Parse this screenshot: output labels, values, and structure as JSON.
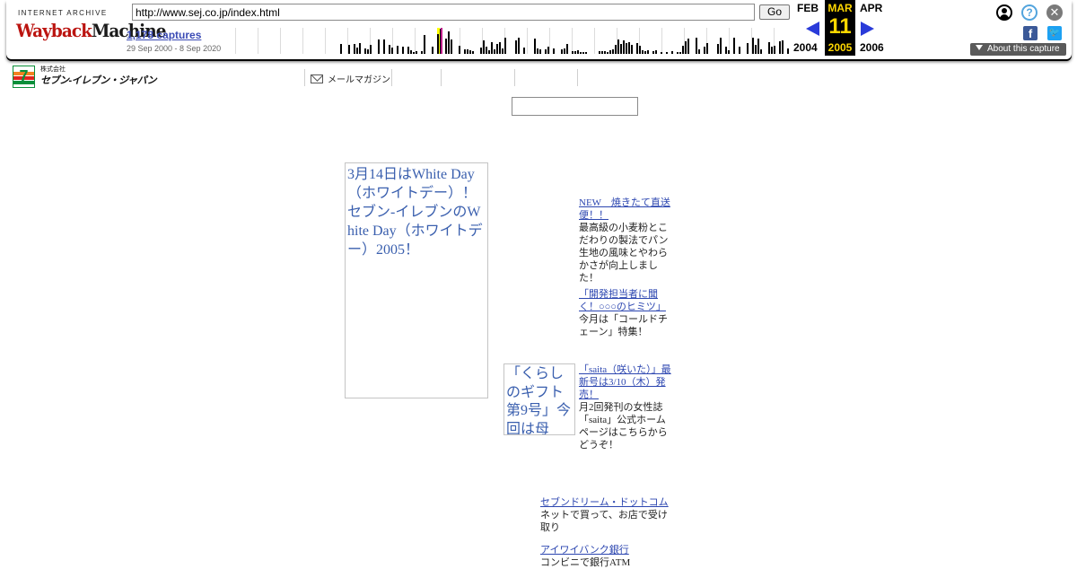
{
  "wayback": {
    "logo_top": "INTERNET ARCHIVE",
    "logo_red": "Wayback",
    "logo_black": "Machine",
    "url": "http://www.sej.co.jp/index.html",
    "go_label": "Go",
    "captures": "1,178 captures",
    "date_range": "29 Sep 2000 - 8 Sep 2020",
    "prev_month": "FEB",
    "prev_year": "2004",
    "current_month": "MAR",
    "current_day": "11",
    "current_year": "2005",
    "next_month": "APR",
    "next_year": "2006",
    "about_label": "About this capture",
    "icons": [
      "user-icon",
      "help-icon",
      "close-icon",
      "facebook-icon",
      "twitter-icon"
    ],
    "accent_color": "#2a3bd9",
    "highlight_color": "#ffd700"
  },
  "site": {
    "brand_small": "株式会社",
    "brand_name": "セブン-イレブン・ジャパン",
    "brand_logo_text": "7",
    "nav": {
      "mail_magazine": "メールマガジン"
    },
    "main_banner_alt": "3月14日はWhite Day（ホワイトデー）！　セブン-イレブンのWhite Day（ホワイトデー）2005！",
    "gift_banner_alt": "「くらしのギフト第9号」今回は母",
    "news": [
      {
        "title": "NEW　焼きたて直送便！！",
        "desc": "最高級の小麦粉とこだわりの製法でパン生地の風味とやわらかさが向上しました！"
      },
      {
        "title": "「開発担当者に聞く！○○○のヒミツ」",
        "desc": "今月は「コールドチェーン」特集！"
      },
      {
        "title": "「saita（咲いた）」最新号は3/10（木）発売！",
        "desc": "月2回発刊の女性誌「saita」公式ホームページはこちらからどうぞ！"
      }
    ],
    "services": [
      {
        "title": "セブンドリーム・ドットコム",
        "desc": "ネットで買って、お店で受け取り"
      },
      {
        "title": "アイワイバンク銀行",
        "desc": "コンビニで銀行ATM"
      }
    ]
  }
}
